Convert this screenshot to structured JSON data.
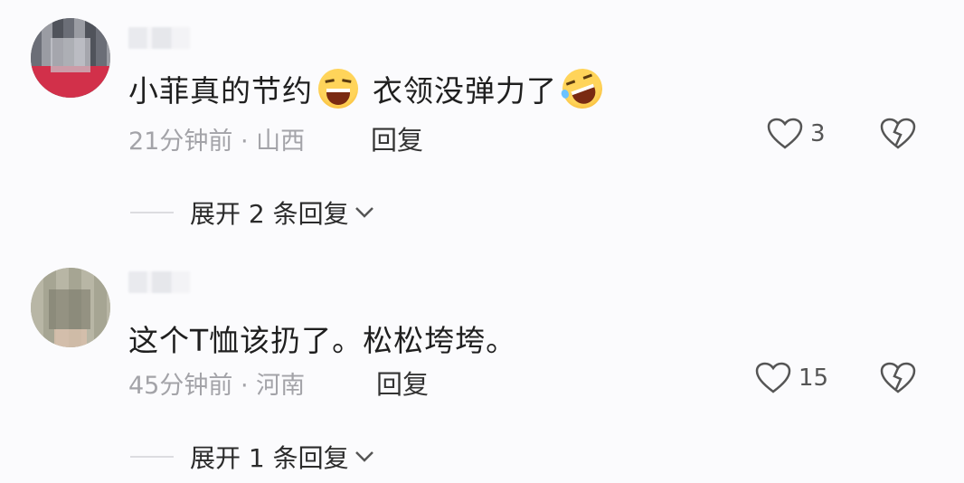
{
  "comments": [
    {
      "text_a": "小菲真的节约",
      "text_b": "衣领没弹力了",
      "emoji_a": "grinning-squint-emoji",
      "emoji_b": "rofl-emoji",
      "time": "21分钟前",
      "separator": "·",
      "location": "山西",
      "reply_label": "回复",
      "like_count": "3",
      "expand_label": "展开 2 条回复"
    },
    {
      "text": "这个T恤该扔了。松松垮垮。",
      "time": "45分钟前",
      "separator": "·",
      "location": "河南",
      "reply_label": "回复",
      "like_count": "15",
      "expand_label": "展开 1 条回复"
    }
  ]
}
